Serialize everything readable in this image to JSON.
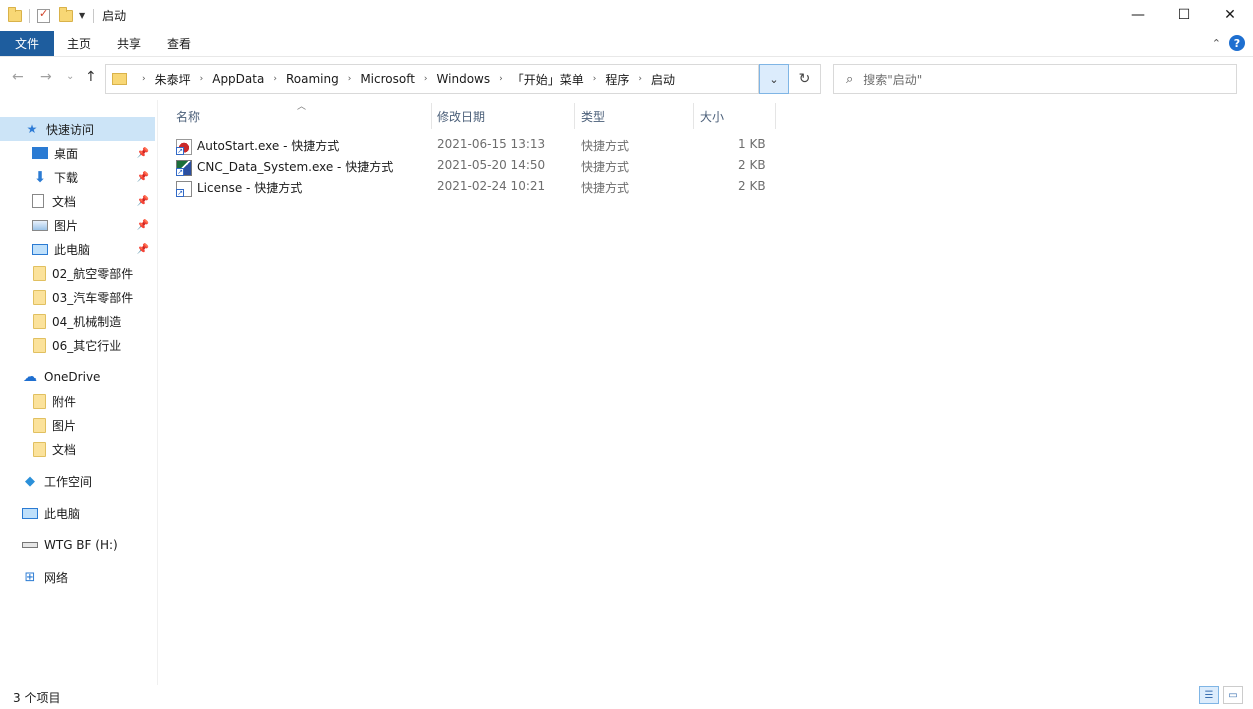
{
  "window": {
    "title": "启动",
    "minimize": "—",
    "maximize": "☐",
    "close": "✕"
  },
  "ribbon": {
    "tabs": [
      "文件",
      "主页",
      "共享",
      "查看"
    ],
    "collapse_icon": "chevron-up-icon",
    "help_label": "?"
  },
  "nav": {
    "back": "←",
    "forward": "→",
    "recent": "⌄",
    "up": "↑"
  },
  "address": {
    "crumbs": [
      "朱泰坪",
      "AppData",
      "Roaming",
      "Microsoft",
      "Windows",
      "「开始」菜单",
      "程序",
      "启动"
    ],
    "dropdown": "⌄",
    "refresh": "↻"
  },
  "search": {
    "placeholder": "搜索\"启动\""
  },
  "sidebar": {
    "quick_access": "快速访问",
    "quick_items": [
      {
        "label": "桌面",
        "pinned": true
      },
      {
        "label": "下载",
        "pinned": true
      },
      {
        "label": "文档",
        "pinned": true
      },
      {
        "label": "图片",
        "pinned": true
      },
      {
        "label": "此电脑",
        "pinned": true
      },
      {
        "label": "02_航空零部件"
      },
      {
        "label": "03_汽车零部件"
      },
      {
        "label": "04_机械制造"
      },
      {
        "label": "06_其它行业"
      }
    ],
    "onedrive": "OneDrive",
    "onedrive_items": [
      "附件",
      "图片",
      "文档"
    ],
    "workspace": "工作空间",
    "this_pc": "此电脑",
    "drive": "WTG BF (H:)",
    "network": "网络"
  },
  "columns": {
    "name": "名称",
    "date": "修改日期",
    "type": "类型",
    "size": "大小"
  },
  "files": [
    {
      "name": "AutoStart.exe - 快捷方式",
      "date": "2021-06-15 13:13",
      "type": "快捷方式",
      "size": "1 KB",
      "icon": "autostart"
    },
    {
      "name": "CNC_Data_System.exe - 快捷方式",
      "date": "2021-05-20 14:50",
      "type": "快捷方式",
      "size": "2 KB",
      "icon": "cnc"
    },
    {
      "name": "License - 快捷方式",
      "date": "2021-02-24 10:21",
      "type": "快捷方式",
      "size": "2 KB",
      "icon": "doc"
    }
  ],
  "status": {
    "count_text": "3 个项目"
  }
}
